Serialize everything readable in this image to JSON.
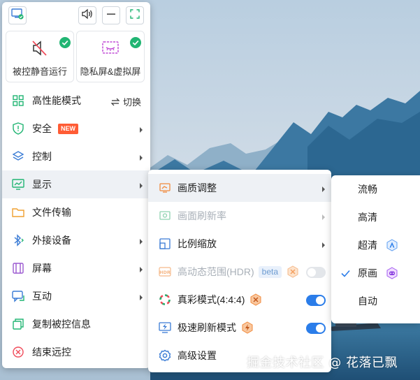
{
  "topbar": {
    "monitor_icon": "monitor-check-icon",
    "volume_icon": "volume-icon",
    "minimize_icon": "minimize-icon",
    "fullscreen_icon": "fullscreen-icon"
  },
  "feature_cards": [
    {
      "label": "被控静音运行",
      "icon": "speaker-mute-icon",
      "checked": true
    },
    {
      "label": "隐私屏&虚拟屏",
      "icon": "privacy-screen-icon",
      "checked": true
    }
  ],
  "menu": {
    "high_performance": {
      "label": "高性能模式",
      "action_label": "切换"
    },
    "security": {
      "label": "安全",
      "badge": "NEW"
    },
    "control": {
      "label": "控制"
    },
    "display": {
      "label": "显示"
    },
    "file_transfer": {
      "label": "文件传输"
    },
    "peripherals": {
      "label": "外接设备"
    },
    "screen": {
      "label": "屏幕"
    },
    "interaction": {
      "label": "互动"
    },
    "copy_info": {
      "label": "复制被控信息"
    },
    "end_remote": {
      "label": "结束远控"
    }
  },
  "display_submenu": {
    "quality": {
      "label": "画质调整"
    },
    "refresh_rate": {
      "label": "画面刷新率"
    },
    "scaling": {
      "label": "比例缩放"
    },
    "hdr": {
      "label": "高动态范围(HDR)",
      "badge": "beta"
    },
    "true_color": {
      "label": "真彩模式(4:4:4)",
      "enabled": true
    },
    "fast_refresh": {
      "label": "极速刷新模式",
      "enabled": true
    },
    "advanced": {
      "label": "高级设置"
    }
  },
  "quality_options": [
    {
      "label": "流畅",
      "selected": false
    },
    {
      "label": "高清",
      "selected": false
    },
    {
      "label": "超清",
      "selected": false,
      "badge_icon": "super-clear-badge-icon"
    },
    {
      "label": "原画",
      "selected": true,
      "badge_icon": "original-badge-icon"
    },
    {
      "label": "自动",
      "selected": false
    }
  ],
  "watermark": "掘金技术社区 @ 花落已飘",
  "colors": {
    "accent": "#2b7de9",
    "new_badge": "#ff5c35",
    "green_check": "#21b573",
    "hex_orange": "#f08a3c"
  }
}
